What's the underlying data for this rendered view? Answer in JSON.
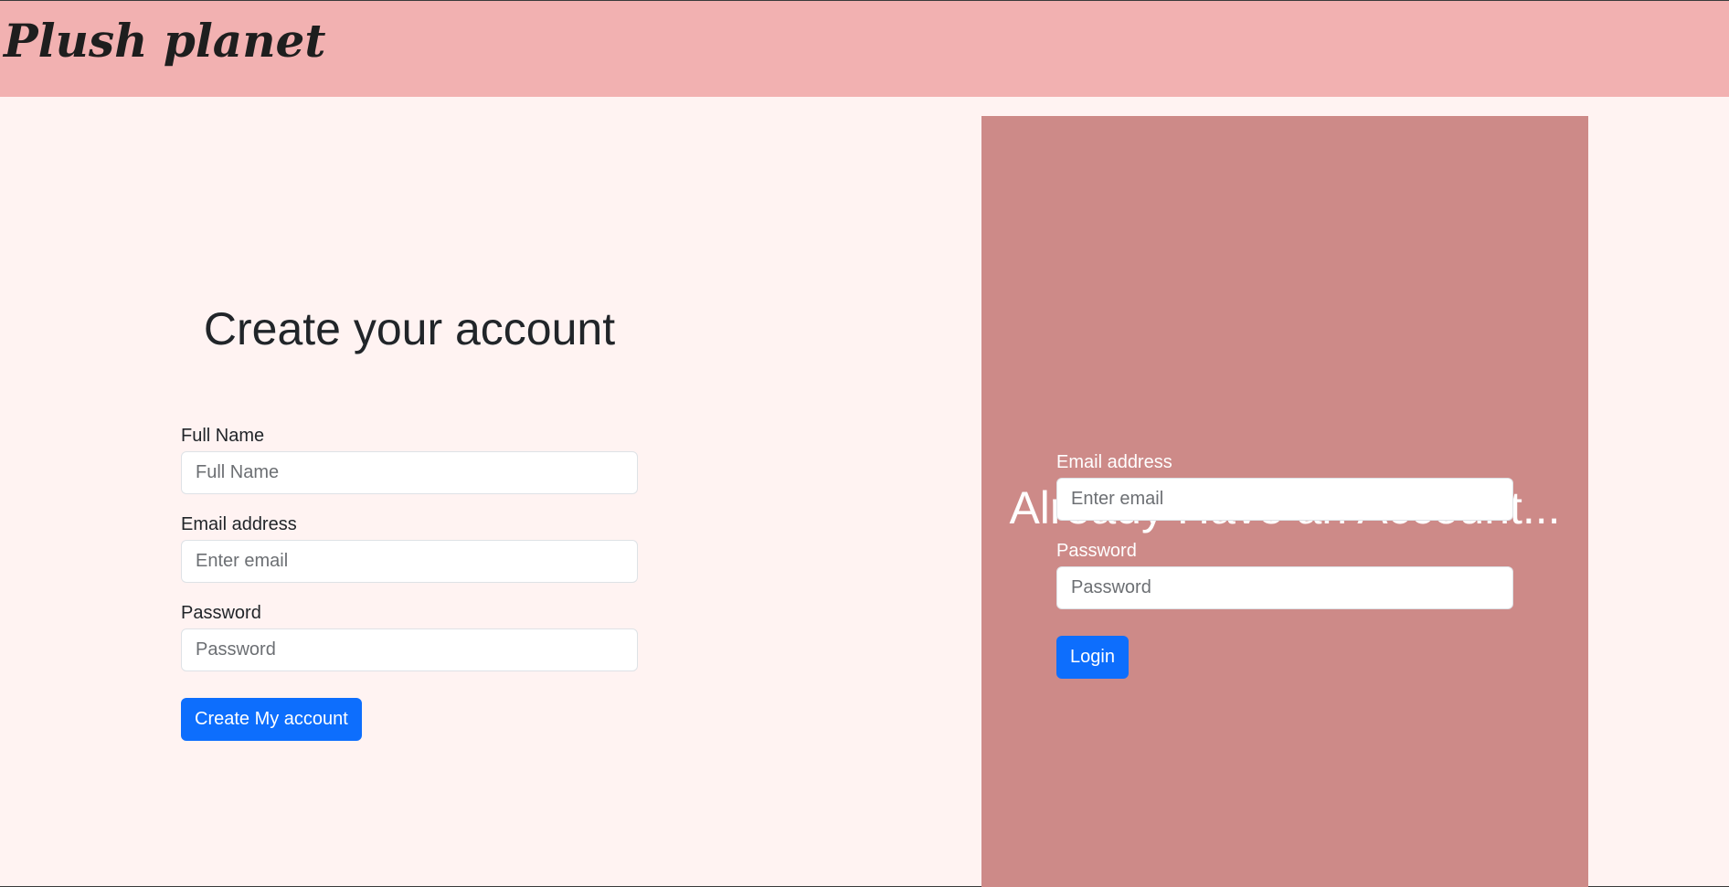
{
  "header": {
    "brand": "Plush planet",
    "background_color": "#f2b1b1"
  },
  "signup": {
    "title": "Create your account",
    "full_name": {
      "label": "Full Name",
      "placeholder": "Full Name",
      "value": ""
    },
    "email": {
      "label": "Email address",
      "placeholder": "Enter email",
      "value": ""
    },
    "password": {
      "label": "Password",
      "placeholder": "Password",
      "value": ""
    },
    "submit_label": "Create My account"
  },
  "login": {
    "title": "Already Have an Account...",
    "panel_color": "#cd8a88",
    "email": {
      "label": "Email address",
      "placeholder": "Enter email",
      "value": ""
    },
    "password": {
      "label": "Password",
      "placeholder": "Password",
      "value": ""
    },
    "submit_label": "Login"
  },
  "colors": {
    "page_background": "#fff3f2",
    "button_primary": "#0d6efd"
  }
}
